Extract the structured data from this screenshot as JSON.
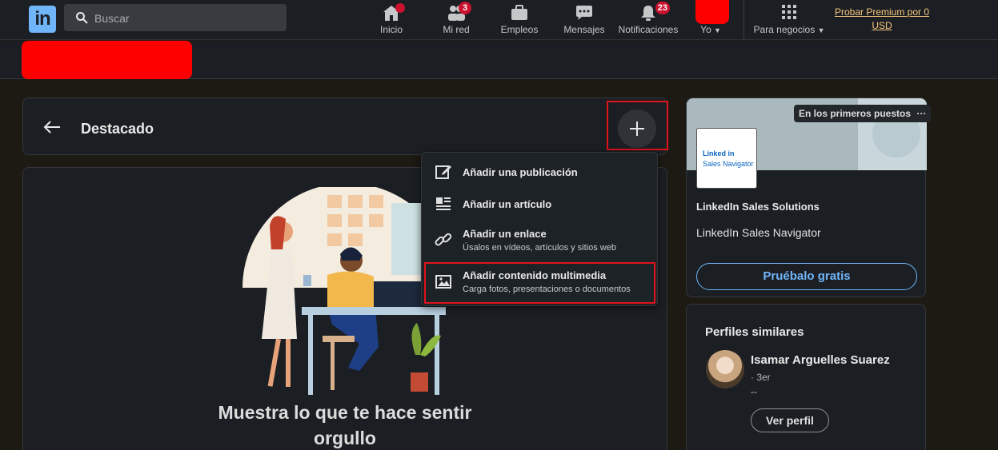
{
  "nav": {
    "logo": "in",
    "search_placeholder": "Buscar",
    "items": [
      {
        "label": "Inicio",
        "badge": ""
      },
      {
        "label": "Mi red",
        "badge": "3"
      },
      {
        "label": "Empleos",
        "badge": ""
      },
      {
        "label": "Mensajes",
        "badge": ""
      },
      {
        "label": "Notificaciones",
        "badge": "23"
      },
      {
        "label": "Yo",
        "badge": ""
      },
      {
        "label": "Para negocios",
        "badge": ""
      }
    ],
    "premium_line1": "Probar Premium por 0",
    "premium_line2": "USD"
  },
  "featured": {
    "title": "Destacado",
    "empty_headline_1": "Muestra lo que te hace sentir",
    "empty_headline_2": "orgullo"
  },
  "add_menu": {
    "items": [
      {
        "title": "Añadir una publicación",
        "subtitle": "",
        "icon": "edit-icon"
      },
      {
        "title": "Añadir un artículo",
        "subtitle": "",
        "icon": "article-icon"
      },
      {
        "title": "Añadir un enlace",
        "subtitle": "Úsalos en vídeos, artículos y sitios web",
        "icon": "link-icon"
      },
      {
        "title": "Añadir contenido multimedia",
        "subtitle": "Carga fotos, presentaciones o documentos",
        "icon": "image-icon"
      }
    ]
  },
  "ad": {
    "tag": "En los primeros puestos",
    "more": "···",
    "logo_line1": "Linked in",
    "logo_line2": "Sales Navigator",
    "company": "LinkedIn Sales Solutions",
    "product": "LinkedIn Sales Navigator",
    "cta": "Pruébalo gratis"
  },
  "similar": {
    "title": "Perfiles similares",
    "people": [
      {
        "name": "Isamar Arguelles Suarez",
        "degree": "· 3er",
        "headline": "--",
        "cta": "Ver perfil"
      }
    ]
  },
  "colors": {
    "accent": "#70b5f9",
    "badge": "#cb112d",
    "highlight": "#e0121b",
    "redaction": "#ff0000"
  }
}
